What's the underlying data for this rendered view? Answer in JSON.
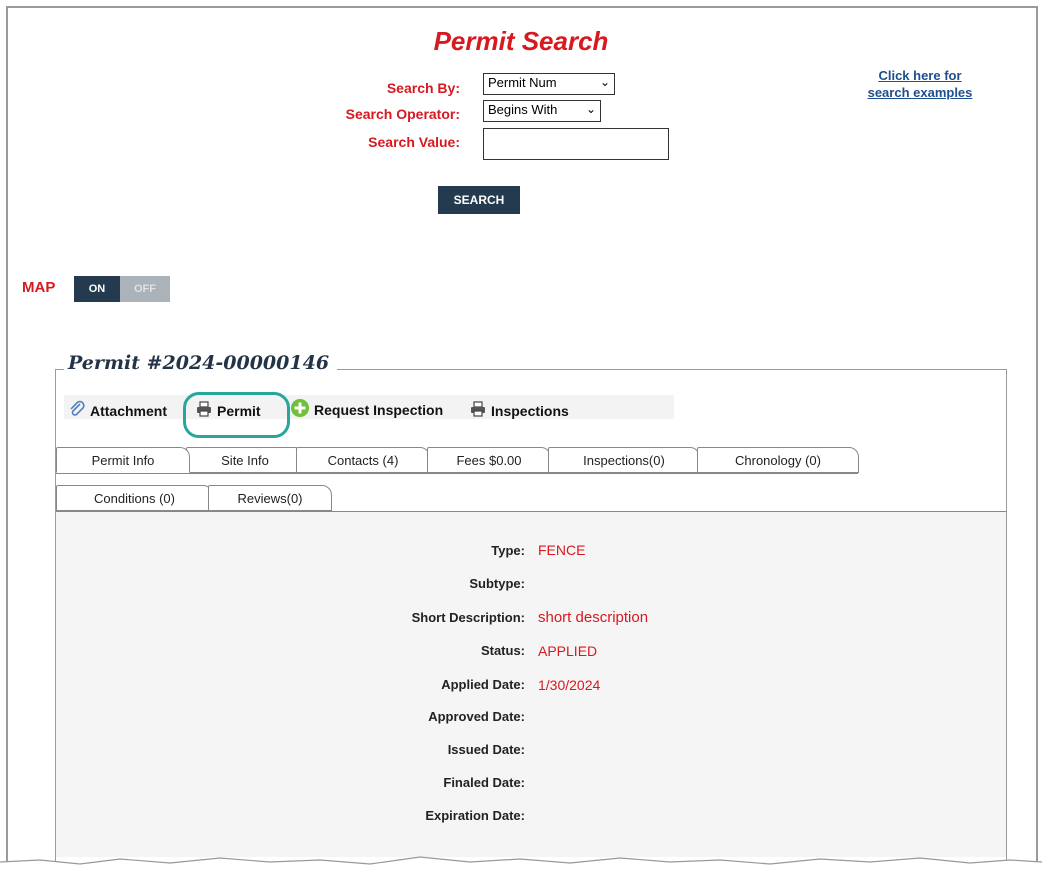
{
  "search": {
    "title": "Permit Search",
    "search_by_label": "Search By:",
    "search_by_value": "Permit Num",
    "operator_label": "Search Operator:",
    "operator_value": "Begins With",
    "value_label": "Search Value:",
    "value": "",
    "button": "SEARCH",
    "examples_line1": "Click here for",
    "examples_line2": "search examples"
  },
  "map": {
    "label": "MAP",
    "on": "ON",
    "off": "OFF"
  },
  "permit": {
    "heading": "Permit #2024-00000146",
    "actions": {
      "attachment": "Attachment",
      "permit": "Permit",
      "request_inspection": "Request Inspection",
      "inspections": "Inspections"
    },
    "tabs": [
      "Permit Info",
      "Site Info",
      "Contacts (4)",
      "Fees $0.00",
      "Inspections(0)",
      "Chronology (0)",
      "Conditions (0)",
      "Reviews(0)"
    ],
    "fields": [
      {
        "label": "Type:",
        "value": "FENCE"
      },
      {
        "label": "Subtype:",
        "value": ""
      },
      {
        "label": "Short Description:",
        "value": "short description"
      },
      {
        "label": "Status:",
        "value": "APPLIED"
      },
      {
        "label": "Applied Date:",
        "value": "1/30/2024"
      },
      {
        "label": "Approved Date:",
        "value": ""
      },
      {
        "label": "Issued Date:",
        "value": ""
      },
      {
        "label": "Finaled Date:",
        "value": ""
      },
      {
        "label": "Expiration Date:",
        "value": ""
      }
    ]
  },
  "colors": {
    "accent": "#d71920",
    "dark": "#243a4f",
    "highlight": "#27a69b",
    "link": "#1d4f91"
  }
}
